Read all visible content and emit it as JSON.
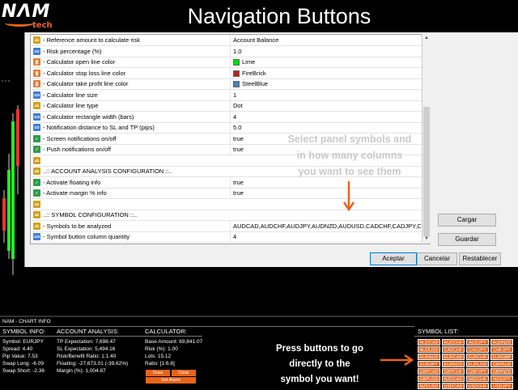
{
  "header": {
    "title": "Navigation Buttons",
    "logo_text": "NΛM",
    "logo_sub": "tech"
  },
  "settings": {
    "rows": [
      {
        "name": "- Reference amount to calculate risk",
        "value": "Account Balance",
        "icon": "enum",
        "color": ""
      },
      {
        "name": "- Risk percentage (%)",
        "value": "1.0",
        "icon": "double",
        "color": ""
      },
      {
        "name": "- Calculator open line color",
        "value": "Lime",
        "icon": "color",
        "color": "#00e000"
      },
      {
        "name": "- Calculator stop loss line color",
        "value": "FireBrick",
        "icon": "color",
        "color": "#b22222"
      },
      {
        "name": "- Calculator take profit line color",
        "value": "SteelBlue",
        "icon": "color",
        "color": "#4682b4"
      },
      {
        "name": "- Calculator line size",
        "value": "1",
        "icon": "int",
        "color": ""
      },
      {
        "name": "- Calculator line type",
        "value": "Dot",
        "icon": "enum",
        "color": ""
      },
      {
        "name": "- Calculator rectangle width (bars)",
        "value": "4",
        "icon": "int",
        "color": ""
      },
      {
        "name": "- Notification distance to SL and TP (pips)",
        "value": "5.0",
        "icon": "double",
        "color": ""
      },
      {
        "name": "- Screen notifications on/off",
        "value": "true",
        "icon": "bool",
        "color": ""
      },
      {
        "name": "- Push notifications on/off",
        "value": "true",
        "icon": "bool",
        "color": ""
      },
      {
        "name": "",
        "value": "",
        "icon": "string",
        "color": ""
      },
      {
        "name": "..:: ACCOUNT ANALYSIS CONFIGURATION ::..",
        "value": "",
        "icon": "string",
        "color": ""
      },
      {
        "name": "- Activate floating info",
        "value": "true",
        "icon": "bool",
        "color": ""
      },
      {
        "name": "- Activate margin % info",
        "value": "true",
        "icon": "bool",
        "color": ""
      },
      {
        "name": "",
        "value": "",
        "icon": "string",
        "color": ""
      },
      {
        "name": "..:: SYMBOL CONFIGURATION ::..",
        "value": "",
        "icon": "string",
        "color": ""
      },
      {
        "name": "- Symbols to be analyzed",
        "value": "AUDCAD,AUDCHF,AUDJPY,AUDNZD,AUDUSD,CADCHF,CADJPY,CHF...",
        "icon": "string",
        "color": ""
      },
      {
        "name": "- Symbol button column quantity",
        "value": "4",
        "icon": "int",
        "color": ""
      }
    ],
    "icon_labels": {
      "enum": "ab",
      "double": "1/2",
      "color": "▓",
      "int": "123",
      "bool": "✓",
      "string": "ab"
    },
    "buttons": {
      "load": "Cargar",
      "save": "Guardar",
      "ok": "Aceptar",
      "cancel": "Cancelar",
      "reset": "Restablecer"
    }
  },
  "annotations": {
    "panel": [
      "Select panel symbols and",
      "in how many columns",
      "you want to see them"
    ],
    "buttons": [
      "Press buttons to go",
      "directly to the",
      "symbol you want!"
    ]
  },
  "panel": {
    "header": "NAM  -  CHART INFO",
    "symbol_info": {
      "title": "SYMBOL INFO:",
      "lines": [
        "Symbol: EURJPY",
        "Spread: 4.40",
        "Pip Value: 7.53",
        "Swap Long: -6.09",
        "Swap Short: -2.36"
      ]
    },
    "account_analysis": {
      "title": "ACCOUNT ANALYSIS:",
      "lines": [
        "TP Expectation: 7,698.47",
        "SL Expectation: 5,494.16",
        "Risk/Benefit Ratio: 1:1.40",
        "Floating: -27,673.01 (-39.62%)",
        "Margin (%): 1,004.87"
      ]
    },
    "calculator": {
      "title": "CALCULATOR:",
      "lines": [
        "Base Amount: 69,841.07",
        "Risk (%): 1.00",
        "Lots: 15.12",
        "Ratio: [1:6.8]"
      ],
      "draw": "Draw",
      "clear": "Clear",
      "set_alarm": "Set Alarm"
    },
    "symbol_list": {
      "title": "SYMBOL LIST:",
      "symbols": [
        "AUDCAD",
        "AUDCHF",
        "AUDJPY",
        "AUDNZD",
        "AUDUSD",
        "CADCHF",
        "CADJPY",
        "CHFJPY",
        "EURAUD",
        "EURCAD",
        "EURCHF",
        "EURGBP",
        "EURJPY",
        "EURNZD",
        "EURUSD",
        "GBPAUD",
        "GBPCAD",
        "GBPCHF",
        "GBPJPY",
        "GBPNZD",
        "GBPUSD",
        "NZDCAD",
        "NZDCHF",
        "NZDJPY",
        "NZDUSD",
        "USDCAD",
        "USDCHF",
        "USDJPY"
      ]
    }
  },
  "colors": {
    "accent": "#e8641a",
    "dialog_bg": "#f0f0f0"
  }
}
